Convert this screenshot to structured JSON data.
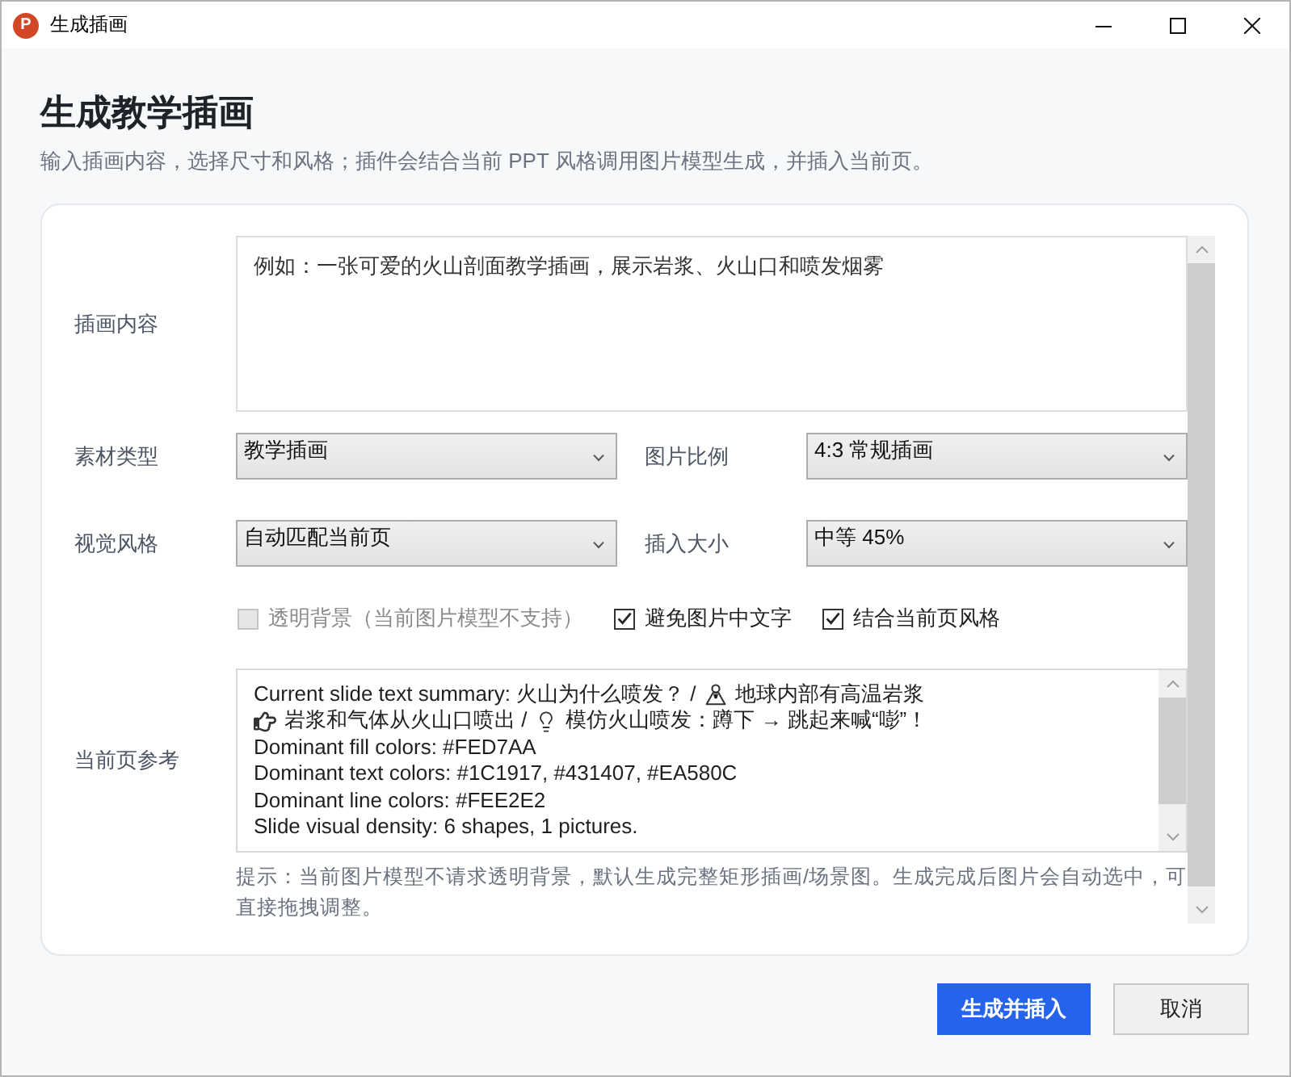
{
  "window": {
    "title": "生成插画",
    "icon_letter": "P"
  },
  "header": {
    "title": "生成教学插画",
    "subtitle": "输入插画内容，选择尺寸和风格；插件会结合当前 PPT 风格调用图片模型生成，并插入当前页。"
  },
  "content_field": {
    "label": "插画内容",
    "placeholder": "例如：一张可爱的火山剖面教学插画，展示岩浆、火山口和喷发烟雾"
  },
  "select_rows": [
    [
      {
        "label": "素材类型",
        "value": "教学插画"
      },
      {
        "label": "图片比例",
        "value": "4:3 常规插画"
      }
    ],
    [
      {
        "label": "视觉风格",
        "value": "自动匹配当前页"
      },
      {
        "label": "插入大小",
        "value": "中等 45%"
      }
    ]
  ],
  "options": [
    {
      "label": "透明背景（当前图片模型不支持）",
      "checked": false,
      "disabled": true
    },
    {
      "label": "避免图片中文字",
      "checked": true,
      "disabled": false
    },
    {
      "label": "结合当前页风格",
      "checked": true,
      "disabled": false
    }
  ],
  "reference": {
    "label": "当前页参考",
    "lines": [
      [
        {
          "kind": "text",
          "text": "Current slide text summary: 火山为什么喷发？ /"
        },
        {
          "kind": "icon"
        },
        {
          "kind": "text",
          "text": "地球内部有高温岩浆"
        }
      ],
      [
        {
          "kind": "icon"
        },
        {
          "kind": "text",
          "text": "岩浆和气体从火山口喷出 /"
        },
        {
          "kind": "icon"
        },
        {
          "kind": "text",
          "text": "模仿火山喷发：蹲下 → 跳起来喊“嘭”！"
        }
      ],
      [
        {
          "kind": "text",
          "text": "Dominant fill colors: #FED7AA"
        }
      ],
      [
        {
          "kind": "text",
          "text": "Dominant text colors: #1C1917, #431407, #EA580C"
        }
      ],
      [
        {
          "kind": "text",
          "text": "Dominant line colors: #FEE2E2"
        }
      ],
      [
        {
          "kind": "text",
          "text": "Slide visual density: 6 shapes, 1 pictures."
        }
      ]
    ]
  },
  "hint": "提示：当前图片模型不请求透明背景，默认生成完整矩形插画/场景图。生成完成后图片会自动选中，可直接拖拽调整。",
  "buttons": [
    {
      "label": "生成并插入",
      "kind": "primary"
    },
    {
      "label": "取消",
      "kind": "secondary"
    }
  ]
}
